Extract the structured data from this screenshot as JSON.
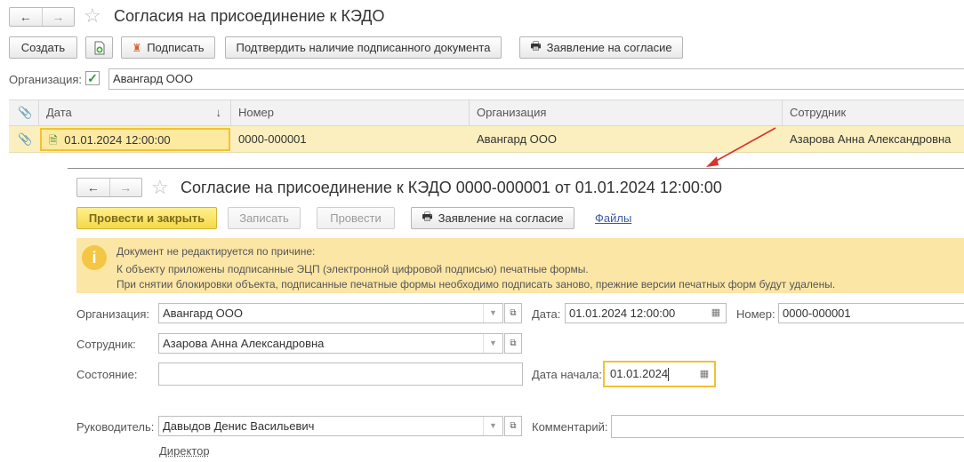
{
  "main": {
    "title": "Согласия на присоединение к КЭДО",
    "toolbar": {
      "create": "Создать",
      "sign": "Подписать",
      "confirm_signed": "Подтвердить наличие подписанного документа",
      "print_consent": "Заявление на согласие"
    },
    "org_filter": {
      "label": "Организация:",
      "checked": true,
      "value": "Авангард ООО"
    },
    "grid": {
      "columns": [
        "Дата",
        "Номер",
        "Организация",
        "Сотрудник"
      ],
      "sort_indicator": "↓",
      "rows": [
        {
          "date": "01.01.2024 12:00:00",
          "number": "0000-000001",
          "org": "Авангард ООО",
          "employee": "Азарова Анна Александровна"
        }
      ]
    }
  },
  "doc": {
    "title": "Согласие на присоединение к КЭДО 0000-000001 от 01.01.2024 12:00:00",
    "toolbar": {
      "post_close": "Провести и закрыть",
      "save": "Записать",
      "post": "Провести",
      "print_consent": "Заявление на согласие",
      "files": "Файлы"
    },
    "warning": {
      "line1": "Документ не редактируется по причине:",
      "line2": "К объекту приложены подписанные ЭЦП (электронной цифровой подписью) печатные формы.",
      "line3": "При снятии блокировки объекта, подписанные печатные формы необходимо подписать заново, прежние версии печатных форм будут удалены."
    },
    "form": {
      "org_label": "Организация:",
      "org_value": "Авангард ООО",
      "date_label": "Дата:",
      "date_value": "01.01.2024 12:00:00",
      "number_label": "Номер:",
      "number_value": "0000-000001",
      "employee_label": "Сотрудник:",
      "employee_value": "Азарова Анна Александровна",
      "state_label": "Состояние:",
      "state_value": "",
      "start_date_label": "Дата начала:",
      "start_date_value": "01.01.2024",
      "manager_label": "Руководитель:",
      "manager_value": "Давыдов Денис Васильевич",
      "manager_position": "Директор",
      "comment_label": "Комментарий:",
      "comment_value": ""
    }
  },
  "colors": {
    "accent_yellow": "#f5d94a",
    "selected_row": "#fbefbf",
    "warning_bg": "#fce6a6",
    "arrow": "#d9342b"
  }
}
